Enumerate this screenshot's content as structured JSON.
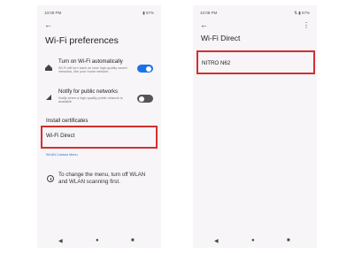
{
  "left": {
    "status_time": "10:08 PM",
    "status_battery": "▮ 57%",
    "title": "Wi-Fi preferences",
    "prefs": [
      {
        "title": "Turn on Wi-Fi automatically",
        "desc": "Wi-Fi will turn back on near high-quality saved networks, like your home network",
        "toggle": "on"
      },
      {
        "title": "Notify for public networks",
        "desc": "Notify when a high-quality public network is available",
        "toggle": "off"
      }
    ],
    "install_certificates": "Install certificates",
    "wifi_direct": "Wi-Fi Direct",
    "wlan_custom_menu": "WLAN Custom Menu",
    "info_text": "To change the menu, turn off WLAN and WLAN scanning first."
  },
  "right": {
    "status_time": "10:08 PM",
    "status_battery": "⇅ ▮ 57%",
    "title": "Wi-Fi Direct",
    "device_name": "NITRO N62"
  },
  "nav": {
    "back": "◀",
    "home": "●",
    "recents": "■"
  },
  "colors": {
    "accent": "#1a73e8",
    "highlight": "#d32f2f"
  }
}
